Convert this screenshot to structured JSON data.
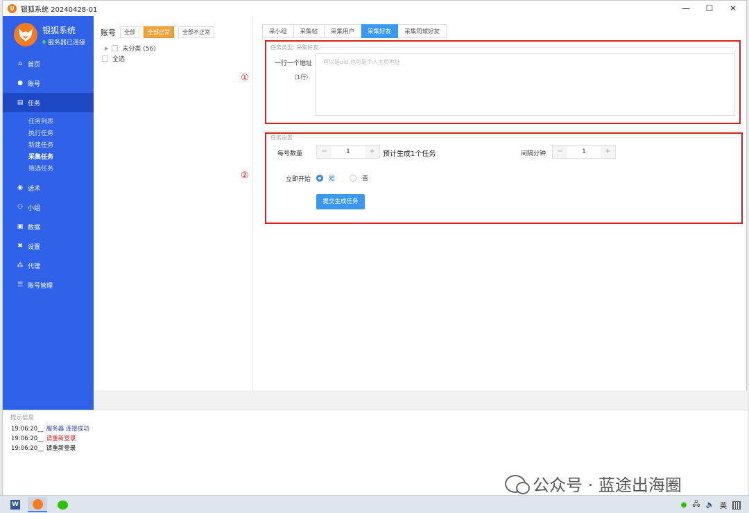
{
  "window": {
    "title": "银狐系统 20240428-01",
    "app_icon_glyph": "U"
  },
  "sidebar": {
    "brand": "银狐系统",
    "status": "服务器已连接",
    "nav": [
      {
        "label": "首页",
        "icon": "home-icon",
        "glyph": "⌂"
      },
      {
        "label": "账号",
        "icon": "user-icon",
        "glyph": "●"
      },
      {
        "label": "任务",
        "icon": "task-icon",
        "glyph": "▤"
      },
      {
        "label": "话术",
        "icon": "chat-icon",
        "glyph": "◉"
      },
      {
        "label": "小组",
        "icon": "group-icon",
        "glyph": "⚇"
      },
      {
        "label": "数据",
        "icon": "data-icon",
        "glyph": "▣"
      },
      {
        "label": "设置",
        "icon": "settings-icon",
        "glyph": "✖"
      },
      {
        "label": "代理",
        "icon": "proxy-icon",
        "glyph": "⁂"
      },
      {
        "label": "账号管理",
        "icon": "database-icon",
        "glyph": "☰"
      }
    ],
    "task_sub": [
      "任务列表",
      "执行任务",
      "新建任务",
      "采集任务",
      "筛选任务"
    ]
  },
  "accounts": {
    "title": "账号",
    "chips": [
      "全部",
      "全部正常",
      "全部不正常"
    ],
    "tree": {
      "label": "未分类 (56)"
    },
    "select_all": "全选"
  },
  "tabs": [
    "采小组",
    "采集帖",
    "采集用户",
    "采集好友",
    "采集同城好友"
  ],
  "task_type": {
    "legend": "任务类型: 采集好友",
    "label": "一行一个地址",
    "sub": "（1行）",
    "placeholder": "可以是uid,也可是个人主页地址"
  },
  "task_settings": {
    "legend": "任务设置",
    "per_account_label": "每号数量",
    "per_account_value": "1",
    "predict": "预计生成1个任务",
    "interval_label": "间隔分钟",
    "interval_value": "1",
    "start_label": "立即开始",
    "yes": "是",
    "no": "否",
    "submit": "提交生成任务"
  },
  "annotations": [
    "①",
    "②"
  ],
  "log": {
    "title": "提示信息",
    "lines": [
      {
        "time": "19:06:20__",
        "msg": "服务器 连接成功"
      },
      {
        "time": "19:06:20__",
        "msg": "请重新登录"
      },
      {
        "time": "19:06:20__",
        "msg": "请重新登录"
      }
    ]
  },
  "watermark": "公众号 · 蓝途出海圈",
  "taskbar": {
    "word_glyph": "W",
    "tray_lang": "英"
  },
  "colors": {
    "sidebar": "#2f62e8",
    "accent": "#3a98f0",
    "chip_on": "#f0a33a",
    "highlight_box": "#d81f1f"
  }
}
